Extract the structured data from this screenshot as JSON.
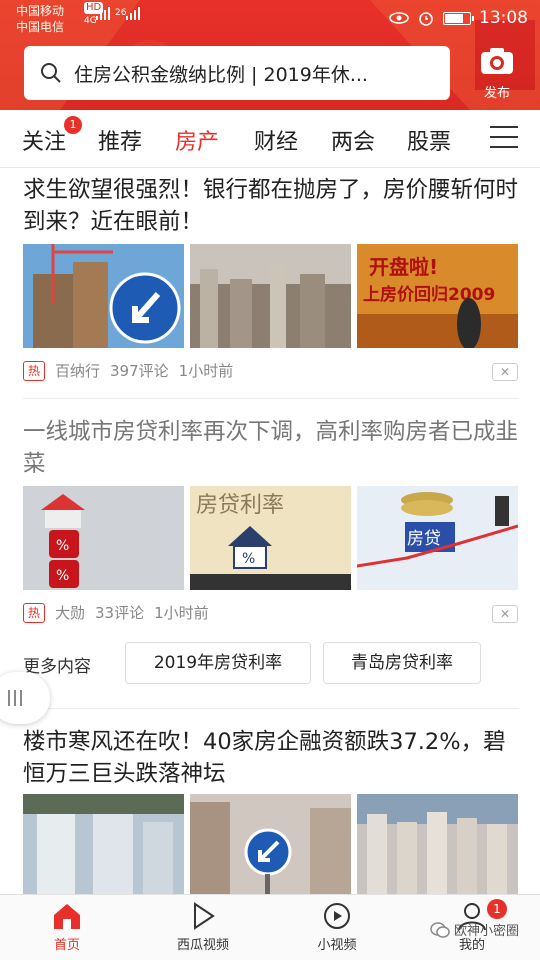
{
  "status_bar": {
    "carrier1": "中国移动",
    "carrier2": "中国电信",
    "net_hd": "HD",
    "net_4g": "4G",
    "net_26": "26",
    "time": "13:08"
  },
  "search": {
    "placeholder": "住房公积金缴纳比例 | 2019年休..."
  },
  "publish": {
    "label": "发布"
  },
  "tabs": [
    {
      "label": "关注",
      "badge": "1"
    },
    {
      "label": "推荐"
    },
    {
      "label": "房产",
      "active": true
    },
    {
      "label": "财经"
    },
    {
      "label": "两会"
    },
    {
      "label": "股票"
    }
  ],
  "articles": [
    {
      "title": "求生欲望很强烈！银行都在抛房了，房价腰斩何时到来？近在眼前！",
      "hot": "热",
      "source": "百纳行",
      "comments": "397评论",
      "time": "1小时前",
      "thumb_texts": [
        "开盘啦!",
        "上房价回归2009"
      ]
    },
    {
      "title": "一线城市房贷利率再次下调，高利率购房者已成韭菜",
      "hot": "热",
      "source": "大勋",
      "comments": "33评论",
      "time": "1小时前",
      "thumb_texts": [
        "%",
        "%",
        "房贷利率",
        "%",
        "房贷"
      ]
    },
    {
      "title": "楼市寒风还在吹！40家房企融资额跌37.2%，碧恒万三巨头跌落神坛"
    }
  ],
  "more": {
    "label": "更多内容",
    "chips": [
      "2019年房贷利率",
      "青岛房贷利率"
    ]
  },
  "bottom_nav": [
    {
      "label": "首页",
      "icon": "home-icon",
      "active": true
    },
    {
      "label": "西瓜视频",
      "icon": "play-icon"
    },
    {
      "label": "小视频",
      "icon": "short-video-icon"
    },
    {
      "label": "我的",
      "icon": "user-icon",
      "badge": "1"
    }
  ],
  "watermark": "欧神小密圈",
  "colors": {
    "accent": "#e8302a",
    "header": "#d92a24"
  }
}
